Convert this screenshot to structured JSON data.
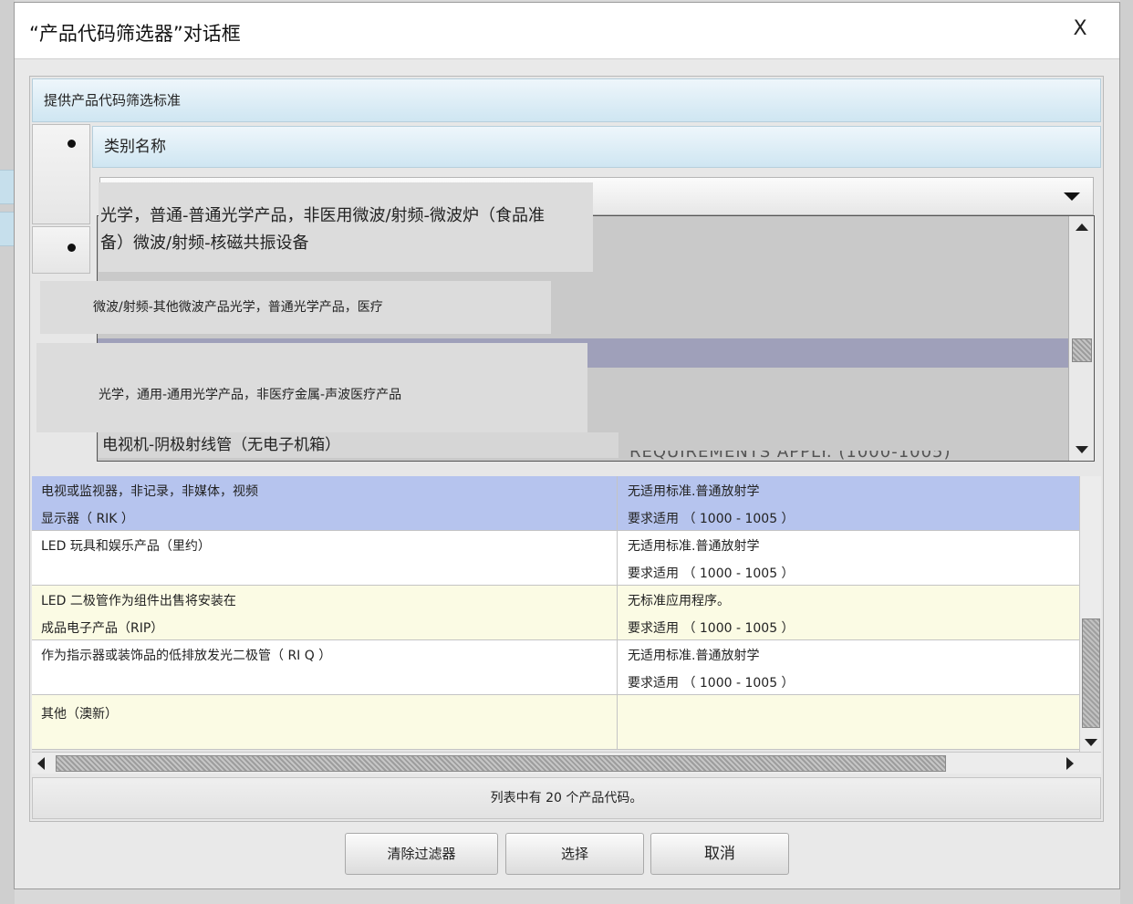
{
  "dialog": {
    "title": "“产品代码筛选器”对话框",
    "close_label": "X"
  },
  "filter": {
    "header": "提供产品代码筛选标准",
    "category_label": "类别名称"
  },
  "dropdown": {
    "options": [
      "光学，普通-普通光学产品，非医用微波/射频-微波炉（食品准备）微波/射频-核磁共振设备",
      "微波/射频-其他微波产品光学，普通光学产品，医疗",
      "光学，通用-通用光学产品，非医疗金属-声波医疗产品",
      "电视机-阴极射线管（无电子机箱）"
    ],
    "option1_line1": "光学，普通-普通光学产品，非医用微波/射频-微波炉（食品准",
    "option1_line2": "备）微波/射频-核磁共振设备"
  },
  "table": {
    "partial_header_text": "REQUIREMENTS APPLY. (1000-1005)",
    "rows": [
      {
        "c1_l1": "电视或监视器，非记录，非媒体，视频",
        "c1_l2": "显示器（ RIK ）",
        "c2_l1": "无适用标准.普通放射学",
        "c2_l2": "要求适用 （ 1000 - 1005 ）",
        "state": "selected"
      },
      {
        "c1_l1": "LED 玩具和娱乐产品（里约）",
        "c1_l2": "",
        "c2_l1": "无适用标准.普通放射学",
        "c2_l2": "要求适用 （ 1000 - 1005 ）",
        "state": "white"
      },
      {
        "c1_l1": "LED 二极管作为组件出售将安装在",
        "c1_l2": "成品电子产品（RIP）",
        "c2_l1": "无标准应用程序。",
        "c2_l2": "要求适用 （ 1000 - 1005 ）",
        "state": "yellow"
      },
      {
        "c1_l1": "作为指示器或装饰品的低排放发光二极管（ RI Q ）",
        "c1_l2": "",
        "c2_l1": "无适用标准.普通放射学",
        "c2_l2": "要求适用 （ 1000 - 1005 ）",
        "state": "white"
      },
      {
        "c1_l1": "其他（澳新）",
        "c1_l2": "",
        "c2_l1": "",
        "c2_l2": "",
        "state": "yellow"
      }
    ]
  },
  "status": {
    "count_text": "列表中有 20 个产品代码。"
  },
  "buttons": {
    "clear_label": "清除过滤器",
    "select_label": "选择",
    "cancel_label": "取消"
  },
  "colors": {
    "selected_row": "#b6c4ee",
    "yellow_row": "#fbfbe4",
    "header_band": "#cfe6f2"
  }
}
